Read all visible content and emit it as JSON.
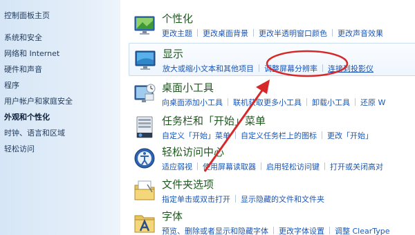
{
  "sidebar": {
    "items": [
      {
        "label": "控制面板主页"
      },
      {
        "label": "系统和安全"
      },
      {
        "label": "网络和 Internet"
      },
      {
        "label": "硬件和声音"
      },
      {
        "label": "程序"
      },
      {
        "label": "用户帐户和家庭安全"
      },
      {
        "label": "外观和个性化",
        "active": true
      },
      {
        "label": "时钟、语言和区域"
      },
      {
        "label": "轻松访问"
      }
    ]
  },
  "main": {
    "categories": [
      {
        "title": "个性化",
        "icon": "personalization-icon",
        "links": [
          "更改主题",
          "更改桌面背景",
          "更改半透明窗口颜色",
          "更改声音效果"
        ]
      },
      {
        "title": "显示",
        "icon": "display-icon",
        "links": [
          "放大或缩小文本和其他项目",
          "调整屏幕分辨率",
          "连接到投影仪"
        ]
      },
      {
        "title": "桌面小工具",
        "icon": "gadgets-icon",
        "links": [
          "向桌面添加小工具",
          "联机获取更多小工具",
          "卸载小工具",
          "还原 W"
        ]
      },
      {
        "title": "任务栏和「开始」菜单",
        "icon": "taskbar-icon",
        "links": [
          "自定义「开始」菜单",
          "自定义任务栏上的图标",
          "更改「开始」"
        ]
      },
      {
        "title": "轻松访问中心",
        "icon": "ease-of-access-icon",
        "links": [
          "适应弱视",
          "使用屏幕读取器",
          "启用轻松访问键",
          "打开或关闭高对"
        ]
      },
      {
        "title": "文件夹选项",
        "icon": "folder-options-icon",
        "links": [
          "指定单击或双击打开",
          "显示隐藏的文件和文件夹"
        ]
      },
      {
        "title": "字体",
        "icon": "fonts-icon",
        "links": [
          "预览、删除或者显示和隐藏字体",
          "更改字体设置",
          "调整 ClearType"
        ]
      }
    ]
  },
  "annotation": {
    "color": "#d62828"
  }
}
